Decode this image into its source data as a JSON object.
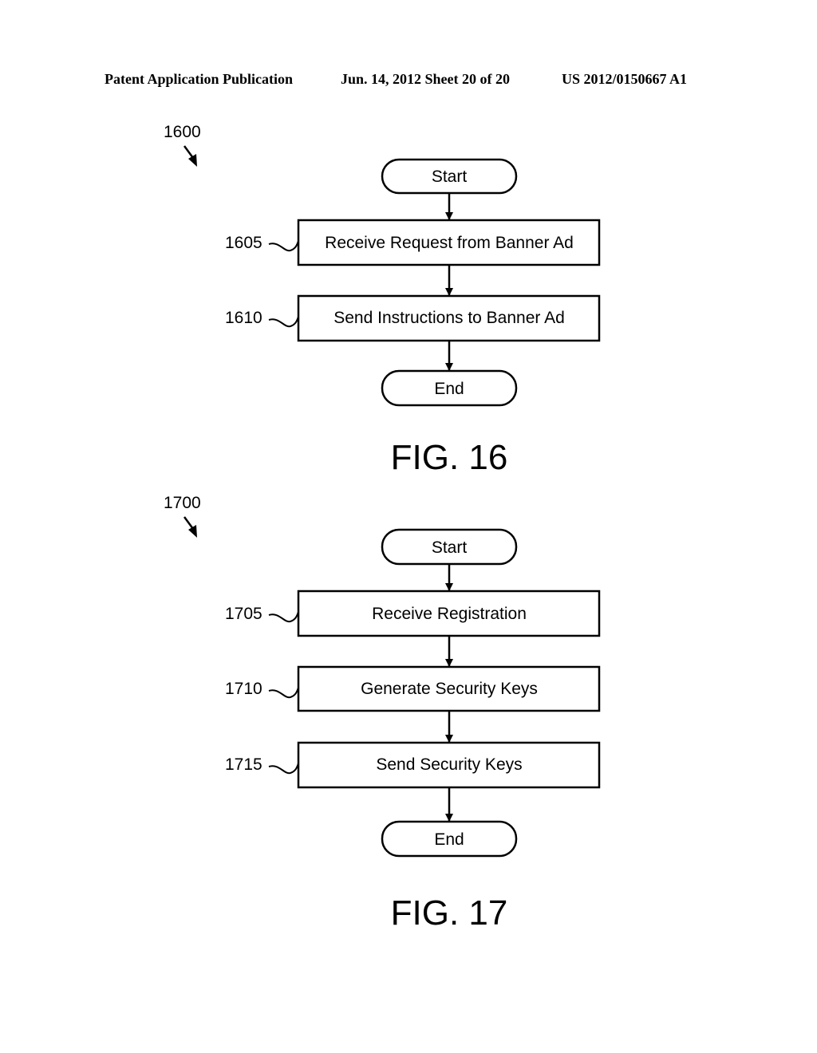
{
  "header": {
    "left": "Patent Application Publication",
    "date_sheet": "Jun. 14, 2012  Sheet 20 of 20",
    "number": "US 2012/0150667 A1"
  },
  "figures": [
    {
      "id": "fig16",
      "ref": "1600",
      "caption": "FIG. 16",
      "nodes": [
        {
          "kind": "terminal",
          "label": "Start",
          "ref": ""
        },
        {
          "kind": "process",
          "label": "Receive Request from Banner Ad",
          "ref": "1605"
        },
        {
          "kind": "process",
          "label": "Send Instructions to Banner Ad",
          "ref": "1610"
        },
        {
          "kind": "terminal",
          "label": "End",
          "ref": ""
        }
      ]
    },
    {
      "id": "fig17",
      "ref": "1700",
      "caption": "FIG. 17",
      "nodes": [
        {
          "kind": "terminal",
          "label": "Start",
          "ref": ""
        },
        {
          "kind": "process",
          "label": "Receive Registration",
          "ref": "1705"
        },
        {
          "kind": "process",
          "label": "Generate Security Keys",
          "ref": "1710"
        },
        {
          "kind": "process",
          "label": "Send Security Keys",
          "ref": "1715"
        },
        {
          "kind": "terminal",
          "label": "End",
          "ref": ""
        }
      ]
    }
  ]
}
